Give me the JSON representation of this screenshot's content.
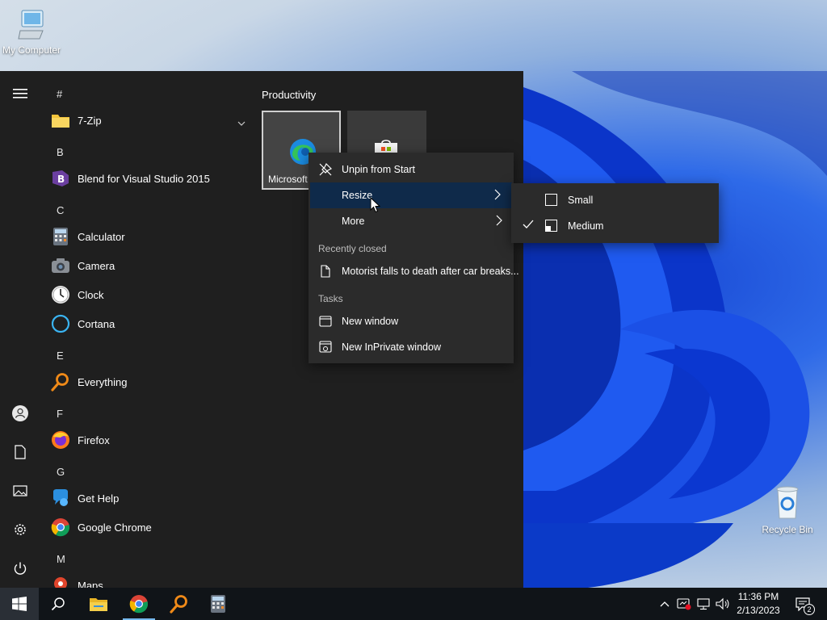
{
  "desktop": {
    "icons": [
      {
        "label": "My Computer",
        "icon": "computer-icon"
      },
      {
        "label": "Recycle Bin",
        "icon": "recycle-bin-icon"
      }
    ]
  },
  "start_menu": {
    "rail": [
      "hamburger-icon",
      "user-icon",
      "documents-icon",
      "pictures-icon",
      "settings-icon",
      "power-icon"
    ],
    "headers": [
      "#",
      "B",
      "C",
      "E",
      "F",
      "G",
      "M"
    ],
    "apps": [
      {
        "label": "7-Zip",
        "icon": "folder-icon"
      },
      {
        "label": "Blend for Visual Studio 2015",
        "icon": "blend-icon"
      },
      {
        "label": "Calculator",
        "icon": "calculator-icon"
      },
      {
        "label": "Camera",
        "icon": "camera-icon"
      },
      {
        "label": "Clock",
        "icon": "clock-icon"
      },
      {
        "label": "Cortana",
        "icon": "cortana-icon"
      },
      {
        "label": "Everything",
        "icon": "everything-icon"
      },
      {
        "label": "Firefox",
        "icon": "firefox-icon"
      },
      {
        "label": "Get Help",
        "icon": "get-help-icon"
      },
      {
        "label": "Google Chrome",
        "icon": "chrome-icon"
      },
      {
        "label": "Maps",
        "icon": "maps-icon"
      }
    ],
    "group_title": "Productivity",
    "tiles": [
      {
        "label": "Microsoft Edge",
        "icon": "edge-icon"
      },
      {
        "label": "",
        "icon": "store-icon"
      }
    ]
  },
  "context_menu": {
    "items": [
      {
        "label": "Unpin from Start",
        "icon": "unpin-icon"
      },
      {
        "label": "Resize",
        "icon": ""
      },
      {
        "label": "More",
        "icon": ""
      }
    ],
    "recently_closed_label": "Recently closed",
    "recent": [
      {
        "label": "Motorist falls to death after car breaks...",
        "icon": "page-icon"
      }
    ],
    "tasks_label": "Tasks",
    "tasks": [
      {
        "label": "New window",
        "icon": "window-icon"
      },
      {
        "label": "New InPrivate window",
        "icon": "inprivate-icon"
      }
    ]
  },
  "resize_submenu": {
    "items": [
      {
        "label": "Small",
        "checked": false
      },
      {
        "label": "Medium",
        "checked": true
      }
    ]
  },
  "taskbar": {
    "buttons": [
      "windows-start-icon",
      "search-icon",
      "file-explorer-icon",
      "chrome-icon",
      "everything-icon",
      "calculator-icon"
    ],
    "time": "11:36 PM",
    "date": "2/13/2023",
    "notification_count": "2"
  },
  "colors": {
    "accent": "#0f2a4a",
    "menu_bg": "#2b2b2b",
    "start_bg": "#1f1f1f"
  }
}
